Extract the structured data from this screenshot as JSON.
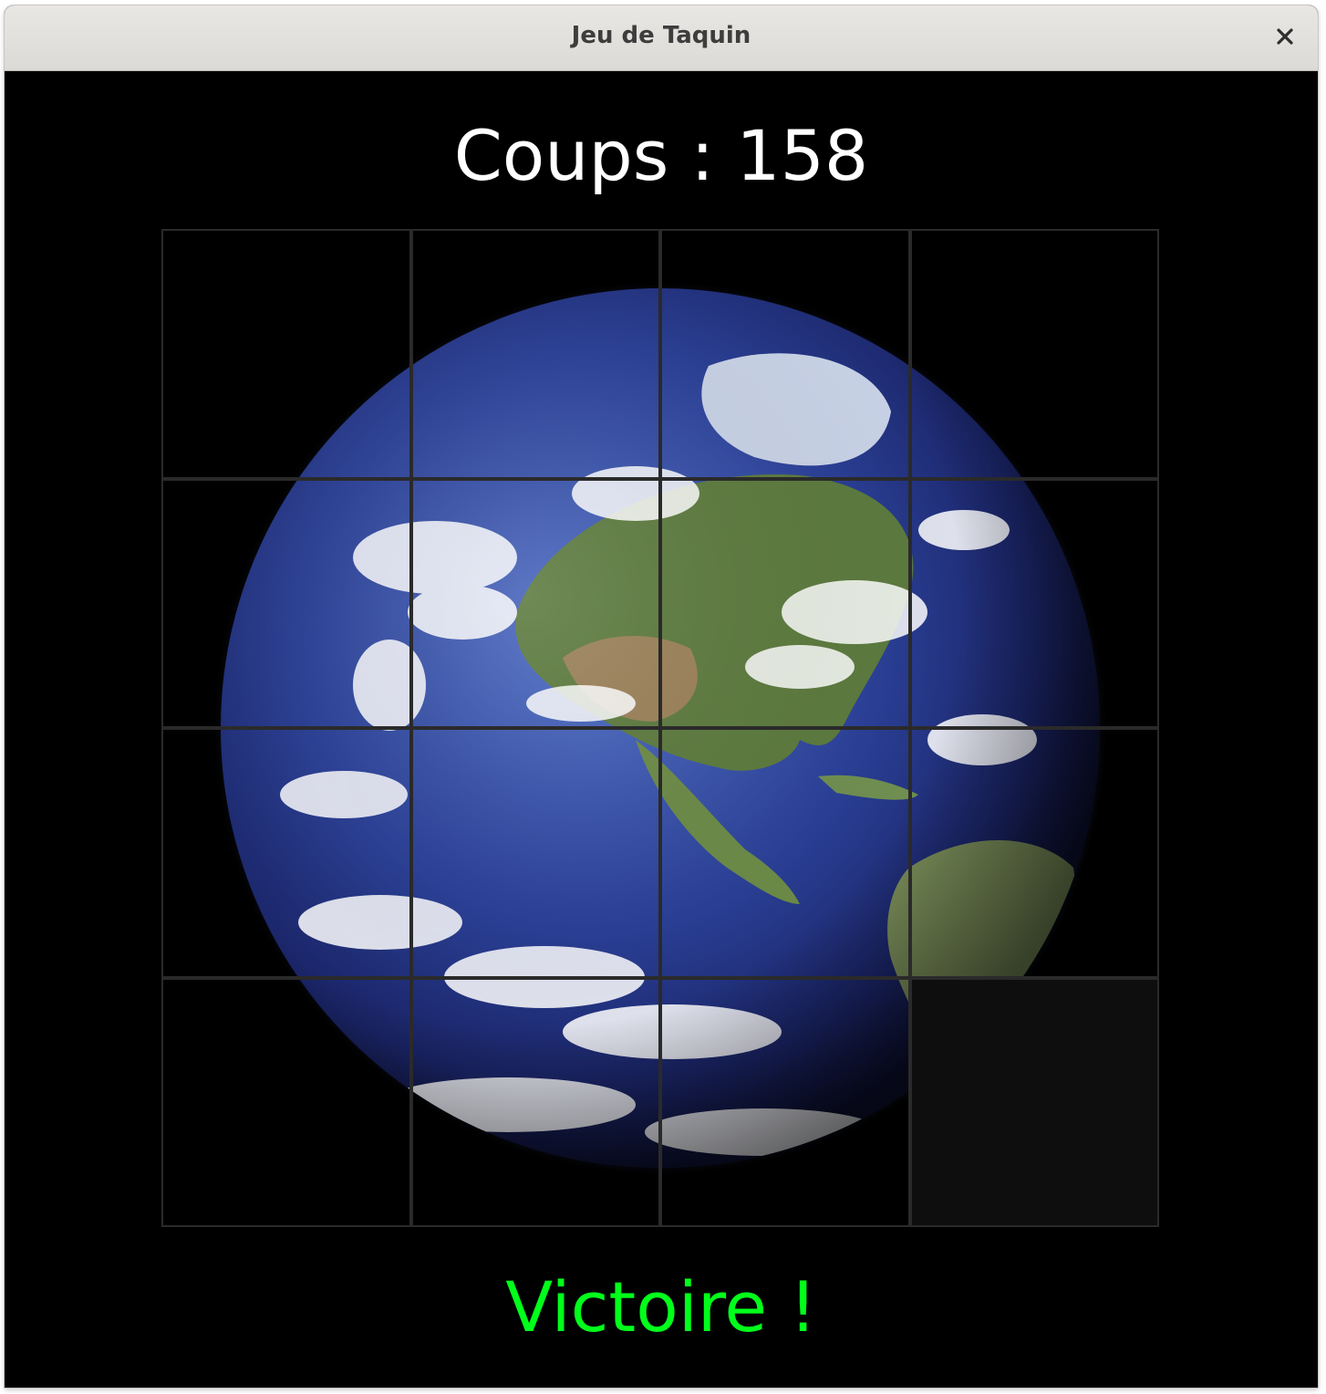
{
  "window": {
    "title": "Jeu de Taquin",
    "close_icon": "close-icon"
  },
  "game": {
    "moves_text": "Coups : 158",
    "status_text": "Victoire !",
    "status_color": "#00ff1a",
    "grid": {
      "rows": 4,
      "cols": 4,
      "empty_tile": 16
    },
    "tile_image": "earth-globe"
  }
}
